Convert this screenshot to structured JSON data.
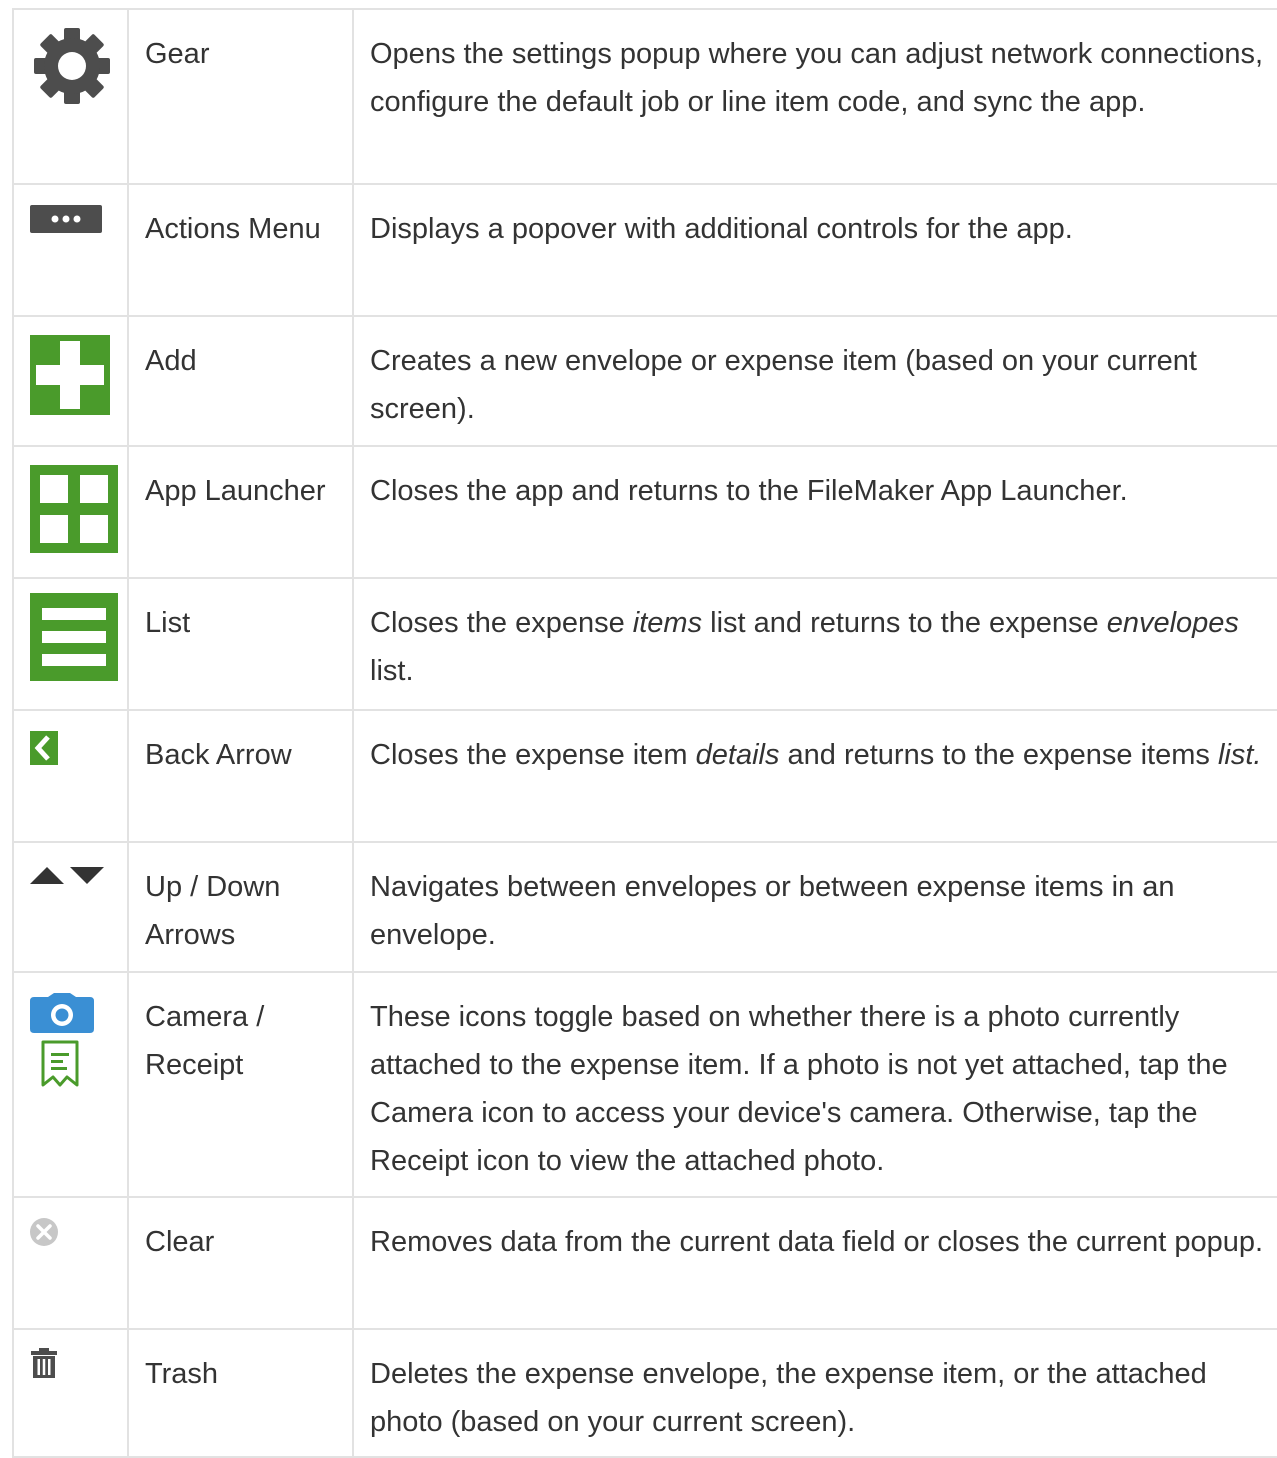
{
  "colors": {
    "green": "#4a9b2b",
    "dark_gray": "#4d4d4d",
    "camera_blue": "#3a8fd4",
    "clear_gray": "#c7c7c7",
    "border": "#e2e2e2"
  },
  "rows": [
    {
      "icon": "gear-icon",
      "name": "Gear",
      "desc": [
        "Opens the settings popup where you can adjust network connections, configure the default job or line item code, and sync the app."
      ]
    },
    {
      "icon": "ellipsis-menu-icon",
      "name": "Actions Menu",
      "desc": [
        "Displays a popover with additional controls for the app."
      ]
    },
    {
      "icon": "plus-icon",
      "name": "Add",
      "desc": [
        "Creates a new envelope or expense item (based on your current screen)."
      ]
    },
    {
      "icon": "app-launcher-grid-icon",
      "name": "App Launcher",
      "desc": [
        "Closes the app and returns to the FileMaker App Launcher."
      ]
    },
    {
      "icon": "list-icon",
      "name": "List",
      "desc": [
        "Closes the expense ",
        "items",
        " list and returns to the expense ",
        "envelopes",
        " list."
      ]
    },
    {
      "icon": "back-arrow-icon",
      "name": "Back Arrow",
      "desc": [
        "Closes the expense item ",
        "details",
        " and returns to the expense items ",
        "list."
      ]
    },
    {
      "icon": "up-down-arrows-icon",
      "name": "Up / Down Arrows",
      "desc": [
        "Navigates between envelopes or between expense items in an envelope."
      ]
    },
    {
      "icon": "camera-receipt-icon",
      "name": "Camera / Receipt",
      "desc": [
        "These icons toggle based on whether there is a photo currently attached to the expense item. If a photo is not yet attached, tap the Camera icon to access your device's camera. Otherwise, tap the Receipt icon to view the attached photo."
      ]
    },
    {
      "icon": "clear-icon",
      "name": "Clear",
      "desc": [
        "Removes data from the current data field or closes the current popup."
      ]
    },
    {
      "icon": "trash-icon",
      "name": "Trash",
      "desc": [
        "Deletes the expense envelope, the expense item, or the attached photo (based on your current screen)."
      ]
    }
  ]
}
